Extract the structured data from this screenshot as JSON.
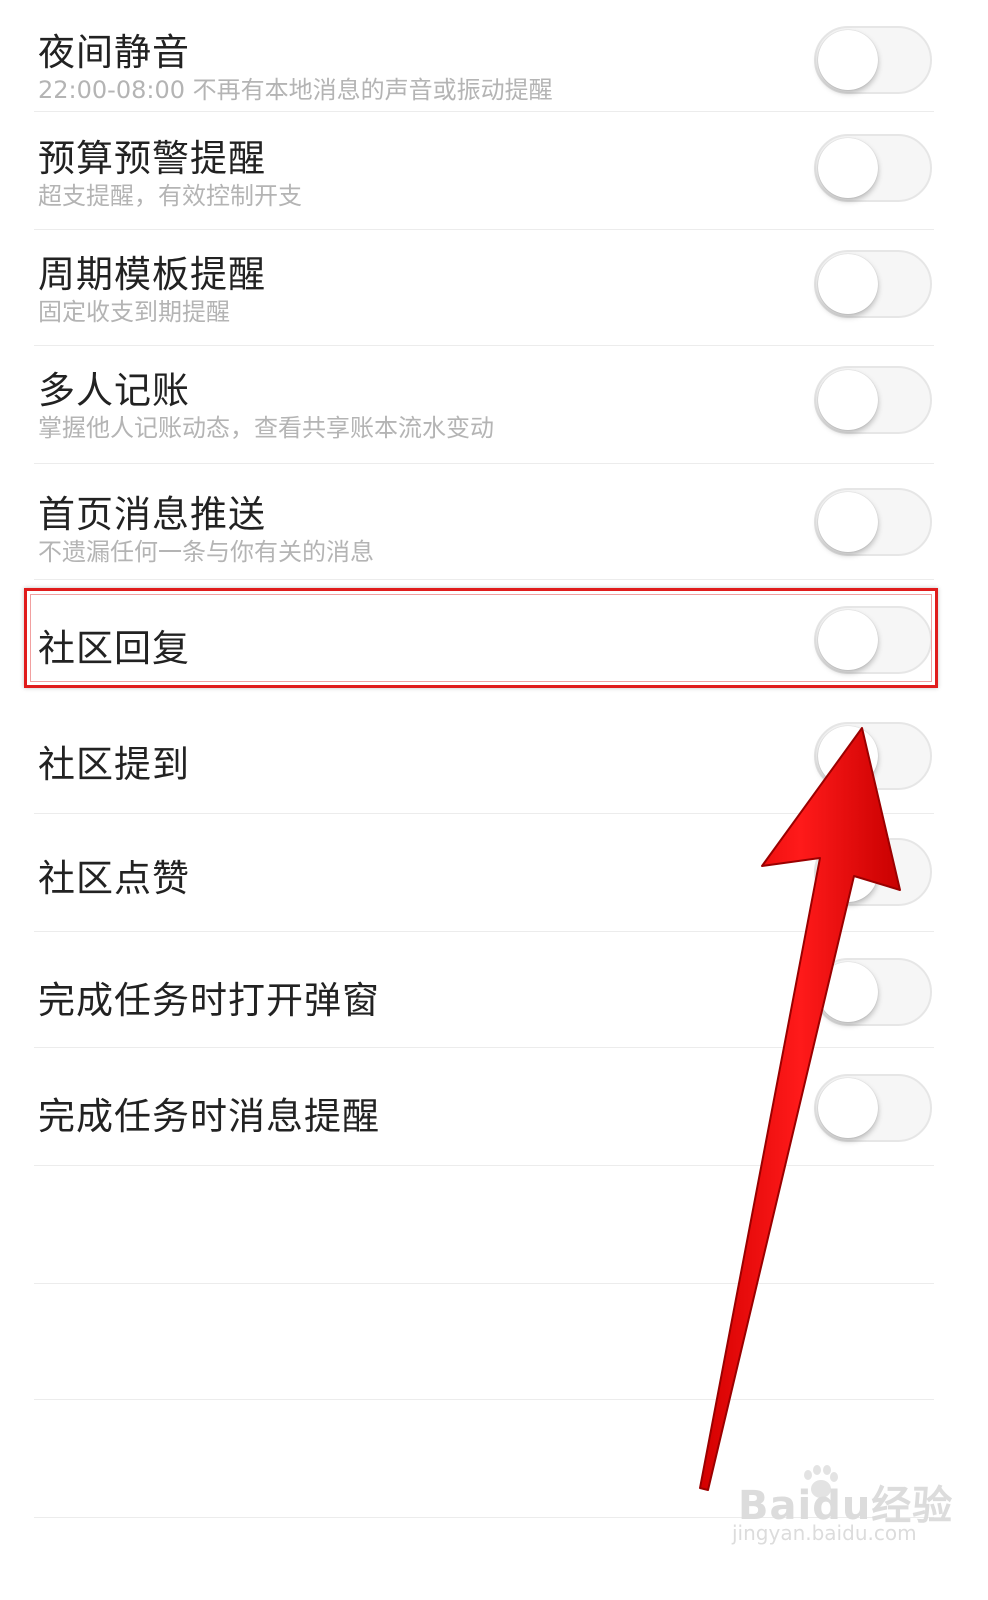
{
  "settings": {
    "items": [
      {
        "title": "夜间静音",
        "subtitle": "22:00-08:00 不再有本地消息的声音或振动提醒",
        "enabled": false
      },
      {
        "title": "预算预警提醒",
        "subtitle": "超支提醒，有效控制开支",
        "enabled": false
      },
      {
        "title": "周期模板提醒",
        "subtitle": "固定收支到期提醒",
        "enabled": false
      },
      {
        "title": "多人记账",
        "subtitle": "掌握他人记账动态，查看共享账本流水变动",
        "enabled": false
      },
      {
        "title": "首页消息推送",
        "subtitle": "不遗漏任何一条与你有关的消息",
        "enabled": false
      },
      {
        "title": "社区回复",
        "enabled": false
      },
      {
        "title": "社区提到",
        "enabled": false
      },
      {
        "title": "社区点赞",
        "enabled": false
      },
      {
        "title": "完成任务时打开弹窗",
        "enabled": false
      },
      {
        "title": "完成任务时消息提醒",
        "enabled": false
      }
    ]
  },
  "annotation": {
    "highlight_color": "#e01b1b",
    "arrow_color": "#ee1111"
  },
  "watermark": {
    "brand": "Baidu经验",
    "url": "jingyan.baidu.com"
  }
}
